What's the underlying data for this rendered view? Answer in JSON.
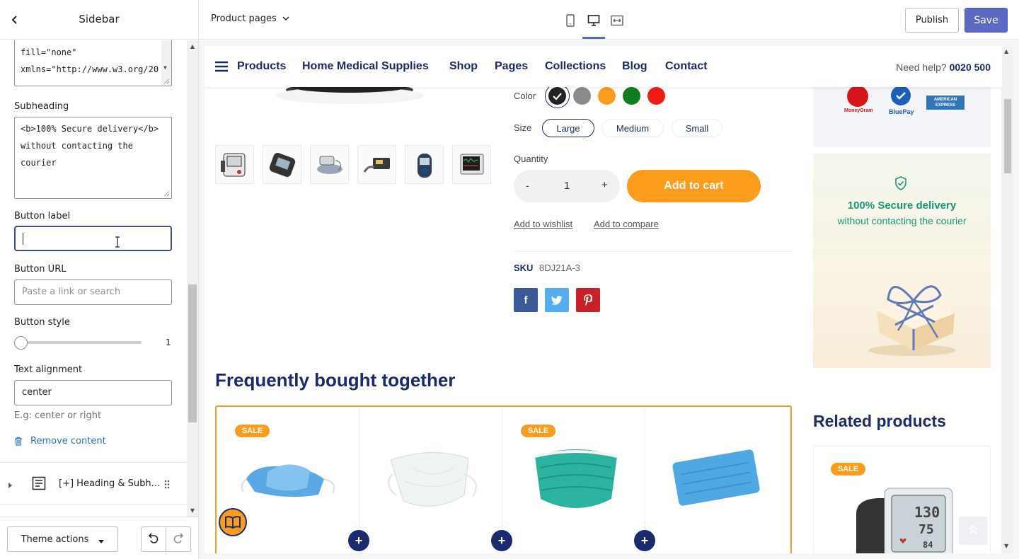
{
  "sidebar": {
    "title": "Sidebar",
    "code_textarea": {
      "line1": "fill=\"none\"",
      "line2": "xmlns=\"http://www.w3.org/20"
    },
    "subheading": {
      "label": "Subheading",
      "line1": "<b>100% Secure delivery</b>",
      "line2": "without contacting the courier"
    },
    "button_label": {
      "label": "Button label",
      "value": ""
    },
    "button_url": {
      "label": "Button URL",
      "placeholder": "Paste a link or search"
    },
    "button_style": {
      "label": "Button style",
      "value": "1"
    },
    "text_alignment": {
      "label": "Text alignment",
      "value": "center",
      "help": "E.g: center or right"
    },
    "remove_content": "Remove content",
    "block_item": "[+] Heading & Subh...",
    "theme_actions": "Theme actions"
  },
  "topbar": {
    "page_select": "Product pages",
    "publish": "Publish",
    "save": "Save"
  },
  "preview": {
    "nav": {
      "items": [
        "Products",
        "Home Medical Supplies",
        "Shop",
        "Pages",
        "Collections",
        "Blog",
        "Contact"
      ],
      "help_label": "Need help?",
      "help_phone": "0020 500"
    },
    "product": {
      "color_label": "Color",
      "colors": [
        "#222222",
        "#8a8a8a",
        "#fb9c1c",
        "#0f7d1e",
        "#ee1c12"
      ],
      "size_label": "Size",
      "sizes": [
        "Large",
        "Medium",
        "Small"
      ],
      "quantity_label": "Quantity",
      "quantity": "1",
      "minus": "-",
      "plus": "+",
      "add_to_cart": "Add to cart",
      "add_to_wishlist": "Add to wishlist",
      "add_to_compare": "Add to compare",
      "sku_label": "SKU",
      "sku_value": "8DJ21A-3",
      "social": [
        "f",
        "t",
        "p"
      ]
    },
    "fbt": {
      "title": "Frequently bought together",
      "sale": "SALE"
    },
    "secure": {
      "title": "100% Secure delivery",
      "subtitle": "without contacting the courier"
    },
    "payment": {
      "moneygram": "MoneyGram",
      "bluepay": "BluePay",
      "amex_1": "AMERICAN",
      "amex_2": "EXPRESS"
    },
    "related": {
      "title": "Related products",
      "sale": "SALE"
    },
    "monitor": {
      "sys": "130",
      "dia": "75",
      "pulse": "84"
    },
    "accent": "#fb9c1c",
    "brand": "#1a2b6d"
  }
}
